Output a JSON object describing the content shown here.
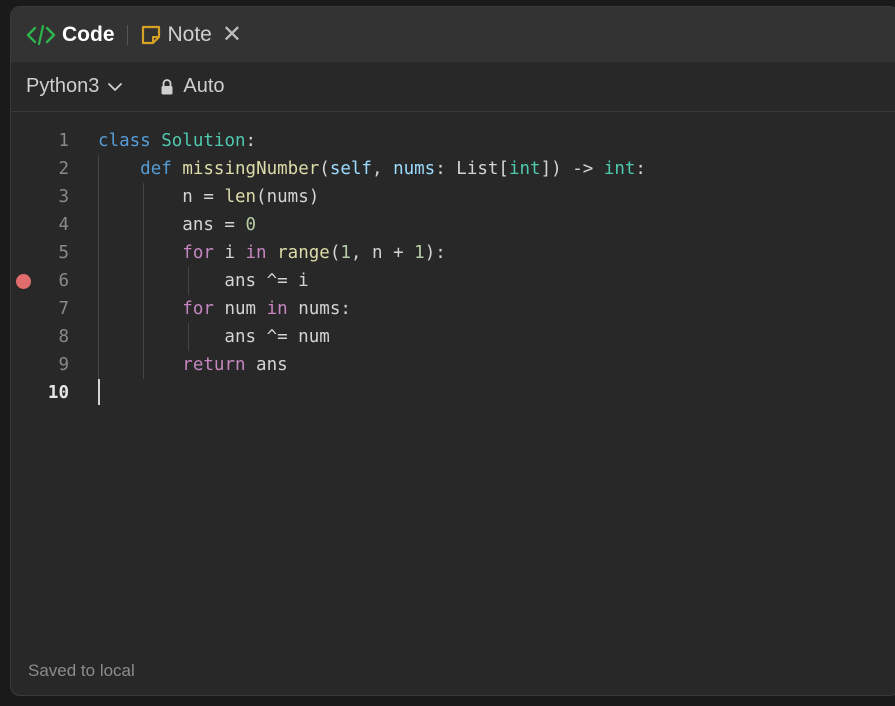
{
  "tabs": {
    "code_label": "Code",
    "note_label": "Note"
  },
  "toolbar": {
    "language": "Python3",
    "mode": "Auto"
  },
  "editor": {
    "line_numbers": [
      "1",
      "2",
      "3",
      "4",
      "5",
      "6",
      "7",
      "8",
      "9",
      "10"
    ],
    "active_line": 10,
    "breakpoint_line": 6
  },
  "status": {
    "save_text": "Saved to local"
  },
  "colors": {
    "accent_green": "#2fb44c",
    "note_icon": "#d6a226",
    "breakpoint": "#e06c6c"
  }
}
